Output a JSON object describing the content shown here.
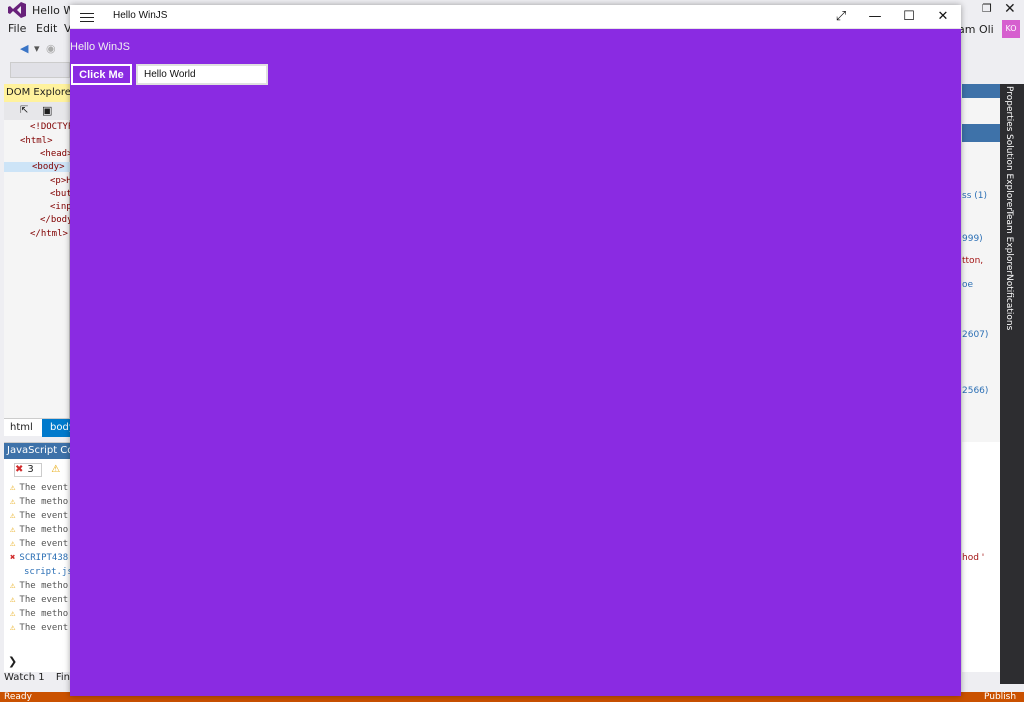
{
  "vs": {
    "title": "Hello Win",
    "menu": [
      "File",
      "Edit",
      "V"
    ],
    "account": "am Oli",
    "avatar_initials": "KO",
    "status": "Ready",
    "publish": "Publish",
    "bottom_tabs": [
      "Watch 1",
      "Find F"
    ]
  },
  "dom_explorer": {
    "tab_label": "DOM Explorer -",
    "lines": [
      "<!DOCTYP",
      "<html>",
      "<head>",
      "<body>",
      "<p>H",
      "<but",
      "<inp",
      "</body",
      "</html>"
    ],
    "breadcrumb": [
      "html",
      "body"
    ]
  },
  "console": {
    "tab_label": "JavaScript Cons",
    "error_count": "3",
    "lines": [
      {
        "type": "warn",
        "text": "The event"
      },
      {
        "type": "warn",
        "text": "The metho"
      },
      {
        "type": "warn",
        "text": "The event"
      },
      {
        "type": "warn",
        "text": "The metho"
      },
      {
        "type": "warn",
        "text": "The event"
      },
      {
        "type": "error",
        "text": "SCRIPT438"
      },
      {
        "type": "none",
        "text": "script.js"
      },
      {
        "type": "warn",
        "text": "The metho"
      },
      {
        "type": "warn",
        "text": "The event"
      },
      {
        "type": "warn",
        "text": "The metho"
      },
      {
        "type": "warn",
        "text": "The event"
      }
    ]
  },
  "right_panel": {
    "snippets": [
      "ss (1)",
      "999)",
      "tton,",
      "oe",
      "2607)",
      "2566)"
    ],
    "console_snip": "hod  '"
  },
  "side_tabs": [
    "Properties",
    "Solution Explorer",
    "Team Explorer",
    "Notifications"
  ],
  "app": {
    "title": "Hello WinJS",
    "heading": "Hello WinJS",
    "button_label": "Click Me",
    "input_value": "Hello World",
    "background": "#8a2be2"
  }
}
